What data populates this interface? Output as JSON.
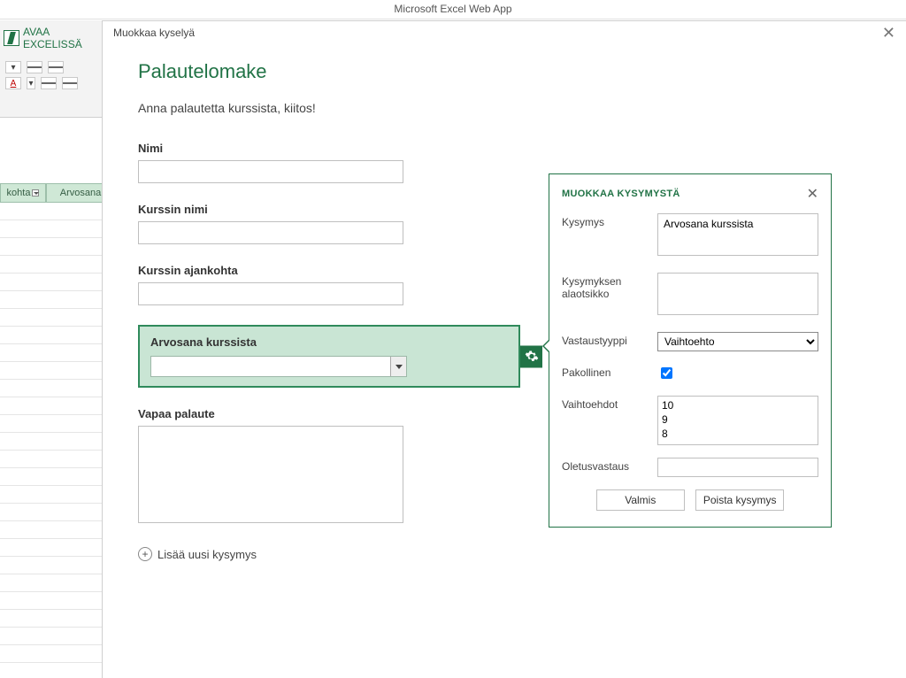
{
  "app": {
    "title": "Microsoft Excel Web App",
    "open_in_excel": "AVAA EXCELISSÄ"
  },
  "sheet": {
    "col1": "kohta",
    "col2": "Arvosana"
  },
  "modal": {
    "title": "Muokkaa kyselyä",
    "survey_title": "Palautelomake",
    "survey_desc": "Anna palautetta kurssista, kiitos!",
    "questions": {
      "q1_label": "Nimi",
      "q2_label": "Kurssin nimi",
      "q3_label": "Kurssin ajankohta",
      "q4_label": "Arvosana kurssista",
      "q5_label": "Vapaa palaute"
    },
    "add_question": "Lisää uusi kysymys"
  },
  "edit_panel": {
    "header": "MUOKKAA KYSYMYSTÄ",
    "labels": {
      "question": "Kysymys",
      "subtitle": "Kysymyksen alaotsikko",
      "response_type": "Vastaustyyppi",
      "required": "Pakollinen",
      "choices": "Vaihtoehdot",
      "default_answer": "Oletusvastaus"
    },
    "values": {
      "question_text": "Arvosana kurssista",
      "subtitle_text": "",
      "response_type_selected": "Vaihtoehto",
      "required_checked": true,
      "choices": [
        "10",
        "9",
        "8"
      ],
      "default_answer": ""
    },
    "buttons": {
      "done": "Valmis",
      "delete": "Poista kysymys"
    }
  }
}
